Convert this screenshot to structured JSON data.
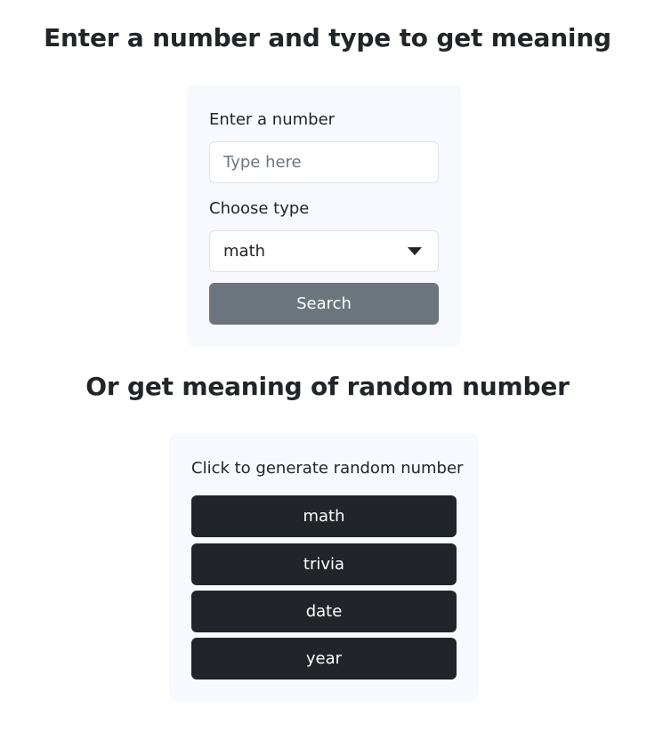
{
  "search_section": {
    "heading": "Enter a number and type to get meaning",
    "number_label": "Enter a number",
    "number_placeholder": "Type here",
    "number_value": "",
    "type_label": "Choose type",
    "type_selected": "math",
    "search_button": "Search"
  },
  "random_section": {
    "heading": "Or get meaning of random number",
    "instruction": "Click to generate random number",
    "buttons": {
      "math": "math",
      "trivia": "trivia",
      "date": "date",
      "year": "year"
    }
  },
  "colors": {
    "card_background": "#f8f9fe",
    "search_button": "#6c757d",
    "random_button": "#212529",
    "text": "#212529"
  },
  "icons": {
    "select_caret": "chevron-down-icon"
  }
}
